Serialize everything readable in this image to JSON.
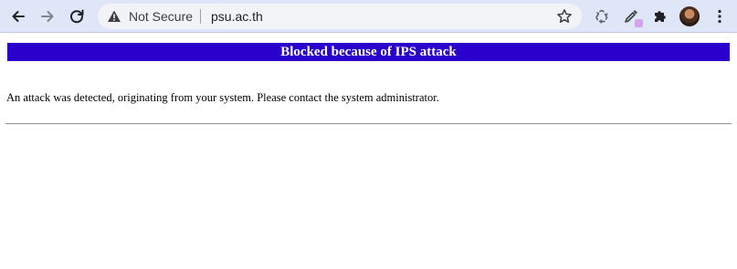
{
  "browser": {
    "security_status": "Not Secure",
    "url": "psu.ac.th",
    "icons": {
      "back": "back-arrow-icon",
      "forward": "forward-arrow-icon",
      "reload": "reload-icon",
      "warning": "warning-triangle-icon",
      "bookmark": "star-icon",
      "extension_1": "recycle-icon",
      "extension_2": "eyedropper-icon",
      "extensions_menu": "puzzle-icon",
      "profile": "avatar",
      "menu": "kebab-menu-icon"
    }
  },
  "page": {
    "banner_title": "Blocked because of IPS attack",
    "message": "An attack was detected, originating from your system. Please contact the system administrator."
  },
  "colors": {
    "banner_background": "#2a00cc",
    "banner_text": "#ffffff",
    "toolbar_background": "#dfe6f7"
  }
}
